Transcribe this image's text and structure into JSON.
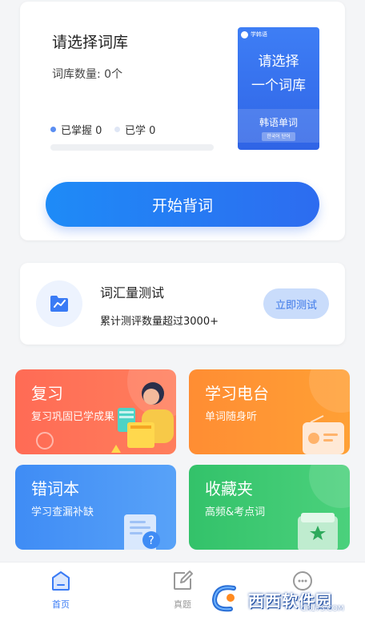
{
  "vocab_card": {
    "title": "请选择词库",
    "count": "词库数量: 0个",
    "mastered": "已掌握 0",
    "learned": "已学 0",
    "progress_fraction": 0,
    "start_button": "开始背词",
    "book": {
      "badge": "学韩语",
      "line1": "请选择",
      "line2": "一个词库",
      "subtitle": "韩语单词",
      "tag": "한국어 단어"
    }
  },
  "test_card": {
    "title": "词汇量测试",
    "description": "累计测评数量超过3000+",
    "button": "立即测试"
  },
  "tiles": [
    {
      "title": "复习",
      "subtitle": "复习巩固已学成果",
      "color": "#ff6b55"
    },
    {
      "title": "学习电台",
      "subtitle": "单词随身听",
      "color": "#ff8d33"
    },
    {
      "title": "错词本",
      "subtitle": "学习查漏补缺",
      "color": "#3f8cf5"
    },
    {
      "title": "收藏夹",
      "subtitle": "高频&考点词",
      "color": "#33c26a"
    }
  ],
  "bottom_nav": {
    "home": "首页",
    "questions": "真题",
    "active_color": "#3a7bf5"
  },
  "watermark": {
    "text": "西西软件园",
    "domain": "CR173.COM"
  }
}
